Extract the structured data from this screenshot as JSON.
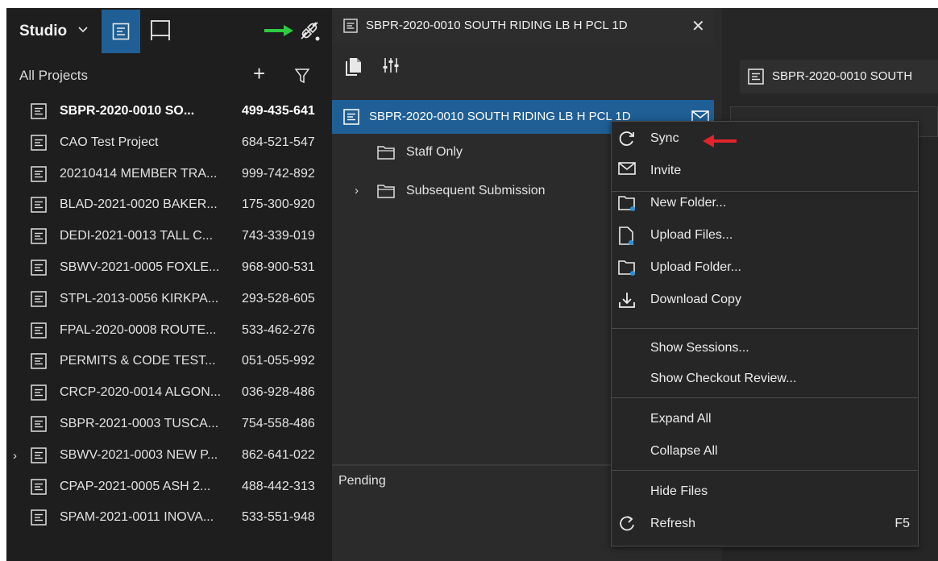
{
  "colors": {
    "accent": "#1f5f95",
    "green_arrow": "#2ecc40",
    "red_arrow": "#e3232b"
  },
  "sidebar": {
    "studio_label": "Studio",
    "all_projects_label": "All Projects",
    "add_symbol": "+",
    "projects": [
      {
        "name": "SBPR-2020-0010 SO...",
        "id": "499-435-641",
        "selected": true,
        "expandable": false
      },
      {
        "name": "CAO Test Project",
        "id": "684-521-547",
        "selected": false,
        "expandable": false
      },
      {
        "name": "20210414 MEMBER TRA...",
        "id": "999-742-892",
        "selected": false,
        "expandable": false
      },
      {
        "name": "BLAD-2021-0020 BAKER...",
        "id": "175-300-920",
        "selected": false,
        "expandable": false
      },
      {
        "name": "DEDI-2021-0013 TALL C...",
        "id": "743-339-019",
        "selected": false,
        "expandable": false
      },
      {
        "name": "SBWV-2021-0005 FOXLE...",
        "id": "968-900-531",
        "selected": false,
        "expandable": false
      },
      {
        "name": "STPL-2013-0056 KIRKPA...",
        "id": "293-528-605",
        "selected": false,
        "expandable": false
      },
      {
        "name": "FPAL-2020-0008 ROUTE...",
        "id": "533-462-276",
        "selected": false,
        "expandable": false
      },
      {
        "name": "PERMITS & CODE TEST...",
        "id": "051-055-992",
        "selected": false,
        "expandable": false
      },
      {
        "name": "CRCP-2020-0014 ALGON...",
        "id": "036-928-486",
        "selected": false,
        "expandable": false
      },
      {
        "name": "SBPR-2021-0003 TUSCA...",
        "id": "754-558-486",
        "selected": false,
        "expandable": false
      },
      {
        "name": "SBWV-2021-0003 NEW P...",
        "id": "862-641-022",
        "selected": false,
        "expandable": true
      },
      {
        "name": "CPAP-2021-0005 ASH 2...",
        "id": "488-442-313",
        "selected": false,
        "expandable": false
      },
      {
        "name": "SPAM-2021-0011 INOVA...",
        "id": "533-551-948",
        "selected": false,
        "expandable": false
      }
    ]
  },
  "tab": {
    "label": "SBPR-2020-0010 SOUTH RIDING LB H PCL 1D",
    "close_symbol": "✕"
  },
  "tree": {
    "root_label": "SBPR-2020-0010 SOUTH RIDING LB H PCL 1D",
    "folders": [
      {
        "label": "Staff Only",
        "expandable": false
      },
      {
        "label": "Subsequent Submission",
        "expandable": true
      }
    ],
    "pending_label": "Pending"
  },
  "right_panel": {
    "title": "SBPR-2020-0010 SOUTH"
  },
  "context_menu": {
    "items": [
      {
        "label": "Sync",
        "icon": "sync-icon"
      },
      {
        "label": "Invite",
        "icon": "mail-icon"
      },
      {
        "label": "New Folder...",
        "icon": "new-folder-icon"
      },
      {
        "label": "Upload Files...",
        "icon": "upload-files-icon"
      },
      {
        "label": "Upload Folder...",
        "icon": "upload-folder-icon"
      },
      {
        "label": "Download Copy",
        "icon": "download-icon"
      },
      {
        "label": "Show Sessions...",
        "icon": ""
      },
      {
        "label": "Show Checkout Review...",
        "icon": ""
      },
      {
        "label": "Expand All",
        "icon": ""
      },
      {
        "label": "Collapse All",
        "icon": ""
      },
      {
        "label": "Hide Files",
        "icon": ""
      },
      {
        "label": "Refresh",
        "icon": "refresh-icon",
        "shortcut": "F5"
      }
    ]
  }
}
